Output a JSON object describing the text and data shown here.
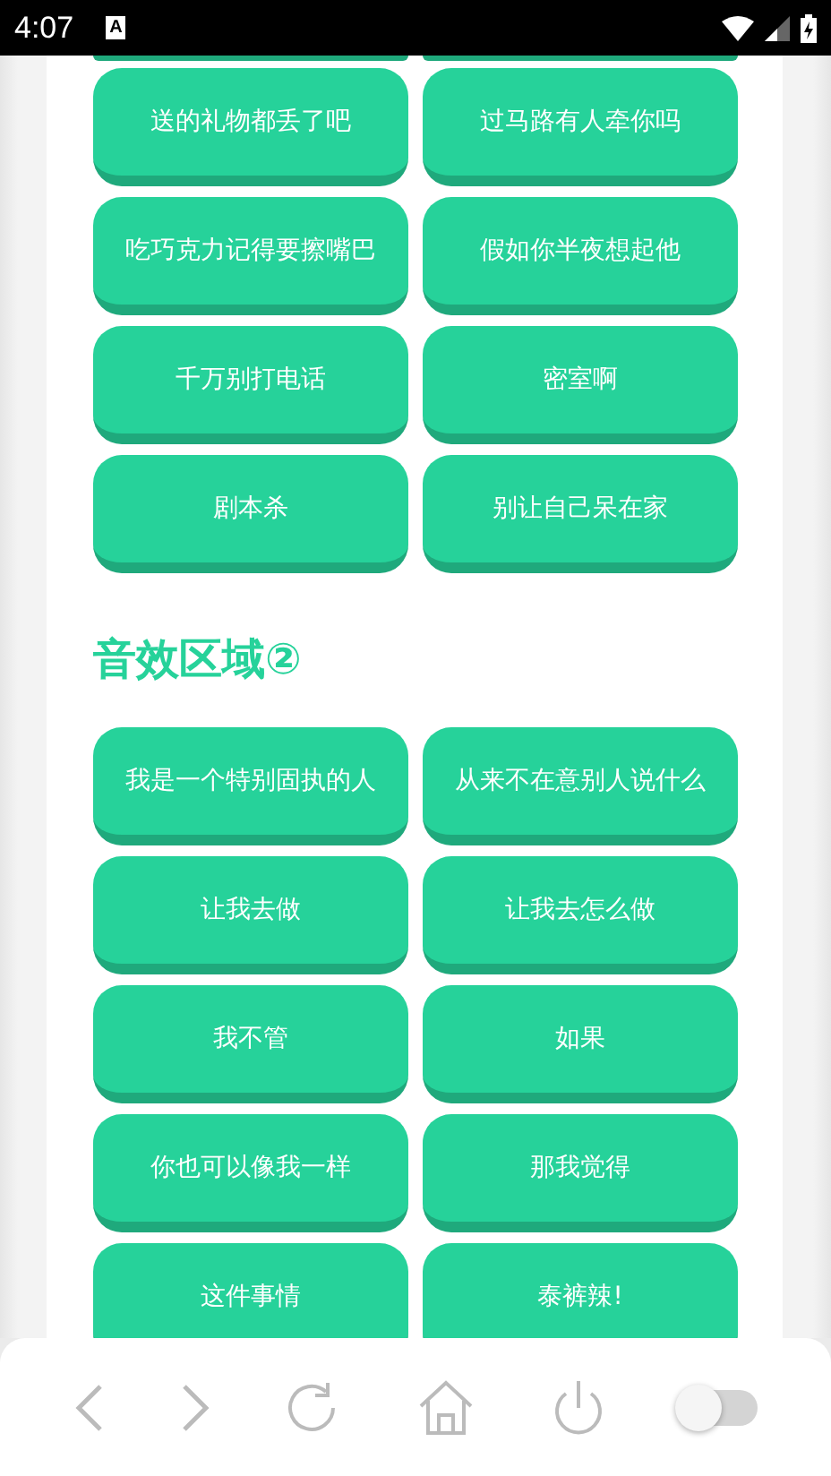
{
  "status_bar": {
    "time": "4:07",
    "notification": "A"
  },
  "sections": [
    {
      "buttons": [
        "送的礼物都丢了吧",
        "过马路有人牵你吗",
        "吃巧克力记得要擦嘴巴",
        "假如你半夜想起他",
        "千万别打电话",
        "密室啊",
        "剧本杀",
        "别让自己呆在家"
      ]
    },
    {
      "title": "音效区域②",
      "buttons": [
        "我是一个特别固执的人",
        "从来不在意别人说什么",
        "让我去做",
        "让我去怎么做",
        "我不管",
        "如果",
        "你也可以像我一样",
        "那我觉得",
        "这件事情",
        "泰裤辣!"
      ]
    }
  ],
  "toolbar": {
    "toggle": {
      "on": false
    }
  }
}
